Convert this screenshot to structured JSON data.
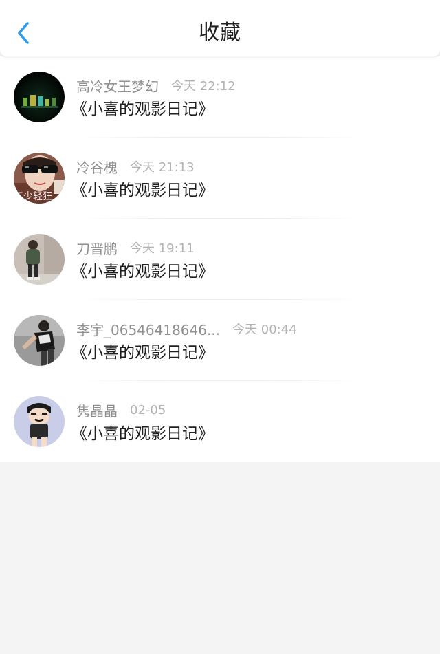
{
  "header": {
    "title": "收藏",
    "back_icon": "chevron-left-icon",
    "accent_color": "#2f9ef0"
  },
  "favorites": [
    {
      "username": "高冷女王梦幻",
      "time": "今天 22:12",
      "title": "《小喜的观影日记》",
      "avatar_icon": "user-avatar"
    },
    {
      "username": "冷谷槐",
      "time": "今天 21:13",
      "title": "《小喜的观影日记》",
      "avatar_icon": "user-avatar",
      "avatar_caption": "年少轻狂"
    },
    {
      "username": "刀晋鹏",
      "time": "今天 19:11",
      "title": "《小喜的观影日记》",
      "avatar_icon": "user-avatar"
    },
    {
      "username": "李宇_06546418646...",
      "time": "今天 00:44",
      "title": "《小喜的观影日记》",
      "avatar_icon": "user-avatar"
    },
    {
      "username": "隽晶晶",
      "time": "02-05",
      "title": "《小喜的观影日记》",
      "avatar_icon": "user-avatar"
    }
  ]
}
